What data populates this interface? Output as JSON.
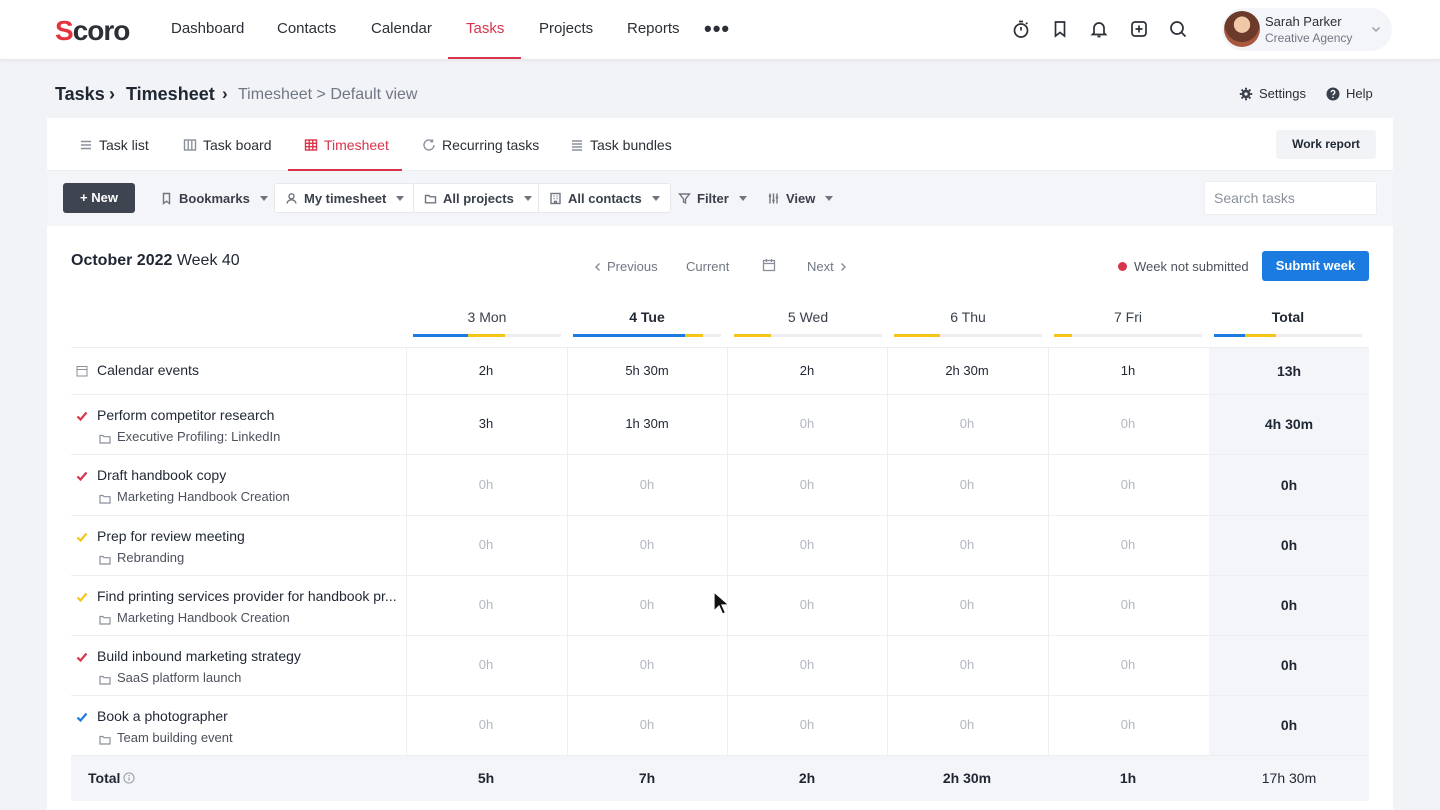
{
  "brand": {
    "logo": "Scoro",
    "accent": "#d8344b",
    "primary": "#1c7be0"
  },
  "nav": {
    "items": [
      "Dashboard",
      "Contacts",
      "Calendar",
      "Tasks",
      "Projects",
      "Reports"
    ],
    "active": "Tasks",
    "more": "•••",
    "icons": [
      "timer-icon",
      "bookmark-icon",
      "bell-icon",
      "add-icon",
      "search-icon"
    ]
  },
  "user": {
    "name": "Sarah Parker",
    "org": "Creative Agency"
  },
  "breadcrumb": {
    "root": "Tasks",
    "sep": "›",
    "current": "Timesheet",
    "view": "Timesheet > Default view"
  },
  "header_links": {
    "settings": "Settings",
    "help": "Help"
  },
  "tabs": [
    {
      "label": "Task list",
      "icon": "list-icon"
    },
    {
      "label": "Task board",
      "icon": "board-icon"
    },
    {
      "label": "Timesheet",
      "icon": "grid-icon"
    },
    {
      "label": "Recurring tasks",
      "icon": "refresh-icon"
    },
    {
      "label": "Task bundles",
      "icon": "bundle-icon"
    }
  ],
  "active_tab": "Timesheet",
  "work_report": "Work report",
  "toolbar": {
    "new": "+ New",
    "bookmarks": "Bookmarks",
    "my_timesheet": "My timesheet",
    "all_projects": "All projects",
    "all_contacts": "All contacts",
    "filter": "Filter",
    "view": "View",
    "search_placeholder": "Search tasks"
  },
  "week": {
    "month": "October 2022",
    "week": "Week 40"
  },
  "pager": {
    "previous": "Previous",
    "current": "Current",
    "next": "Next"
  },
  "status": {
    "text": "Week not submitted",
    "color": "#d8344b"
  },
  "submit": "Submit week",
  "days": [
    {
      "label": "3 Mon",
      "bold": false,
      "bar": [
        {
          "color": "#1c7be0",
          "fraction": 0.37
        },
        {
          "color": "#f5c518",
          "fraction": 0.25
        }
      ]
    },
    {
      "label": "4 Tue",
      "bold": true,
      "bar": [
        {
          "color": "#1c7be0",
          "fraction": 0.76
        },
        {
          "color": "#f5c518",
          "fraction": 0.12
        }
      ]
    },
    {
      "label": "5 Wed",
      "bold": false,
      "bar": [
        {
          "color": "#f5c518",
          "fraction": 0.25
        }
      ]
    },
    {
      "label": "6 Thu",
      "bold": false,
      "bar": [
        {
          "color": "#f5c518",
          "fraction": 0.31
        }
      ]
    },
    {
      "label": "7 Fri",
      "bold": false,
      "bar": [
        {
          "color": "#f5c518",
          "fraction": 0.12
        }
      ]
    },
    {
      "label": "Total",
      "bold": true,
      "bar": [
        {
          "color": "#1c7be0",
          "fraction": 0.21
        },
        {
          "color": "#f5c518",
          "fraction": 0.21
        }
      ]
    }
  ],
  "rows": [
    {
      "label": "Calendar events",
      "sub": "",
      "check_color": "",
      "values": [
        "2h",
        "5h 30m",
        "2h",
        "2h 30m",
        "1h"
      ],
      "total": "13h"
    },
    {
      "label": "Perform competitor research",
      "sub": "Executive Profiling: LinkedIn",
      "check_color": "#d8344b",
      "values": [
        "3h",
        "1h 30m",
        "0h",
        "0h",
        "0h"
      ],
      "total": "4h 30m"
    },
    {
      "label": "Draft handbook copy",
      "sub": "Marketing Handbook Creation",
      "check_color": "#d8344b",
      "values": [
        "0h",
        "0h",
        "0h",
        "0h",
        "0h"
      ],
      "total": "0h"
    },
    {
      "label": "Prep for review meeting",
      "sub": "Rebranding",
      "check_color": "#f5c518",
      "values": [
        "0h",
        "0h",
        "0h",
        "0h",
        "0h"
      ],
      "total": "0h"
    },
    {
      "label": "Find printing services provider for handbook pr...",
      "sub": "Marketing Handbook Creation",
      "check_color": "#f5c518",
      "values": [
        "0h",
        "0h",
        "0h",
        "0h",
        "0h"
      ],
      "total": "0h"
    },
    {
      "label": "Build inbound marketing strategy",
      "sub": "SaaS platform launch",
      "check_color": "#d8344b",
      "values": [
        "0h",
        "0h",
        "0h",
        "0h",
        "0h"
      ],
      "total": "0h"
    },
    {
      "label": "Book a photographer",
      "sub": "Team building event",
      "check_color": "#1c7be0",
      "values": [
        "0h",
        "0h",
        "0h",
        "0h",
        "0h"
      ],
      "total": "0h"
    }
  ],
  "totals": {
    "label": "Total",
    "values": [
      "5h",
      "7h",
      "2h",
      "2h 30m",
      "1h"
    ],
    "total": "17h 30m"
  }
}
